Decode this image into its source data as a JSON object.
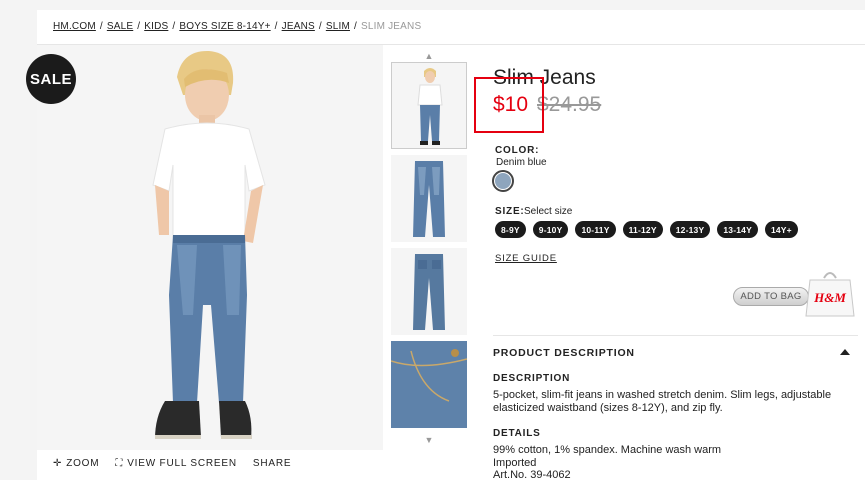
{
  "breadcrumb": {
    "items": [
      "HM.COM",
      "SALE",
      "KIDS",
      "BOYS SIZE 8-14Y+",
      "JEANS",
      "SLIM"
    ],
    "current": "SLIM JEANS",
    "separator": "/"
  },
  "badge": {
    "label": "SALE"
  },
  "image_controls": {
    "zoom": "ZOOM",
    "full_screen": "VIEW FULL SCREEN",
    "share": "SHARE"
  },
  "product": {
    "title": "Slim Jeans",
    "price_now": "$10",
    "price_old": "$24.95",
    "color_label": "COLOR:",
    "color_value": "Denim blue",
    "size_label": "SIZE:",
    "size_select": "Select size",
    "sizes": [
      "8-9Y",
      "9-10Y",
      "10-11Y",
      "11-12Y",
      "12-13Y",
      "13-14Y",
      "14Y+"
    ],
    "size_guide": "SIZE GUIDE",
    "add_to_bag": "ADD TO BAG",
    "bag_brand": "H&M"
  },
  "description": {
    "section_title": "PRODUCT DESCRIPTION",
    "desc_label": "DESCRIPTION",
    "desc_text": "5-pocket, slim-fit jeans in washed stretch denim. Slim legs, adjustable elasticized waistband (sizes 8-12Y), and zip fly.",
    "details_label": "DETAILS",
    "details_lines": [
      "99% cotton, 1% spandex. Machine wash warm",
      "Imported",
      "Art.No. 39-4062"
    ]
  },
  "colors": {
    "sale_red": "#e50010",
    "denim": "#5a7ea8",
    "dark": "#1b1b1b"
  }
}
